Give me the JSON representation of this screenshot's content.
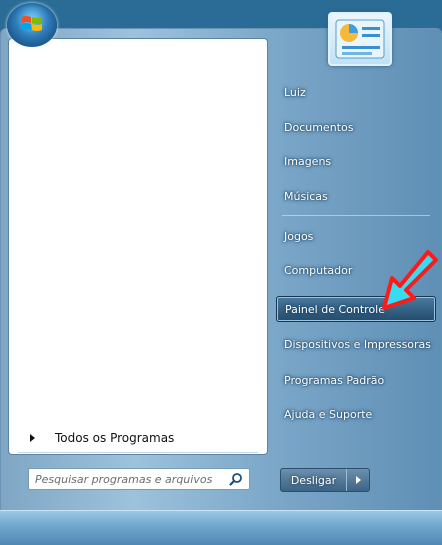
{
  "start_menu": {
    "all_programs_label": "Todos os Programas",
    "search": {
      "placeholder": "Pesquisar programas e arquivos",
      "value": ""
    },
    "right_items": [
      {
        "label": "Luiz"
      },
      {
        "label": "Documentos"
      },
      {
        "label": "Imagens"
      },
      {
        "label": "Músicas"
      },
      {
        "label": "Jogos"
      },
      {
        "label": "Computador"
      },
      {
        "label": "Painel de Controle",
        "highlighted": true
      },
      {
        "label": "Dispositivos e Impressoras"
      },
      {
        "label": "Programas Padrão"
      },
      {
        "label": "Ajuda e Suporte"
      }
    ],
    "shutdown_label": "Desligar"
  },
  "annotation": {
    "type": "arrow",
    "color": "#ff1a1a",
    "fill": "#38dcf2"
  },
  "icons": {
    "user_picture": "control-panel-icon",
    "search": "magnifier-icon",
    "start_orb": "windows-logo-icon"
  }
}
